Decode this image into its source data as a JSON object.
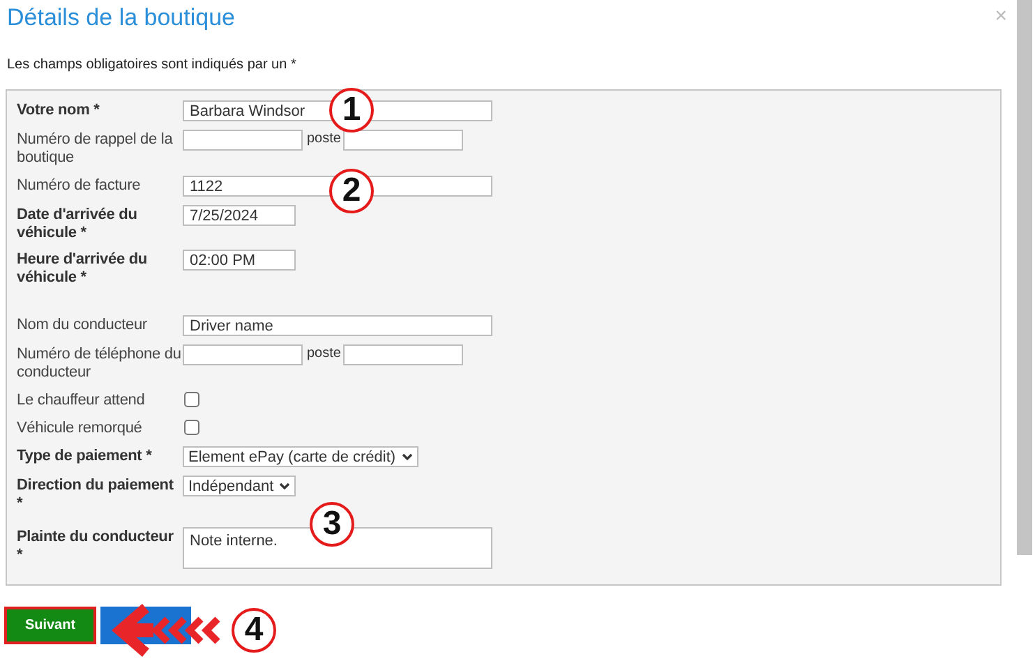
{
  "dialog": {
    "title": "Détails de la boutique",
    "close": "×",
    "note": "Les champs obligatoires sont indiqués par un *"
  },
  "fields": [
    {
      "kind": "text",
      "label": "Votre nom *",
      "required": true,
      "value": "Barbara Windsor"
    },
    {
      "kind": "phone",
      "label": "Numéro de rappel de la boutique",
      "required": false,
      "ext_label": "poste"
    },
    {
      "kind": "text",
      "label": "Numéro de facture",
      "required": false,
      "value": "1122"
    },
    {
      "kind": "short",
      "label": "Date d'arrivée du véhicule *",
      "required": true,
      "value": "7/25/2024"
    },
    {
      "kind": "short",
      "label": "Heure d'arrivée du véhicule *",
      "required": true,
      "value": "02:00 PM"
    },
    {
      "kind": "text",
      "label": "Nom du conducteur",
      "required": false,
      "value": "Driver name"
    },
    {
      "kind": "phone",
      "label": "Numéro de téléphone du conducteur",
      "required": false,
      "ext_label": "poste"
    },
    {
      "kind": "checkbox",
      "label": "Le chauffeur attend",
      "required": false,
      "checked": false
    },
    {
      "kind": "checkbox",
      "label": "Véhicule remorqué",
      "required": false,
      "checked": false
    },
    {
      "kind": "select",
      "label": "Type de paiement *",
      "required": true,
      "value": "Element ePay (carte de crédit)"
    },
    {
      "kind": "select",
      "label": "Direction du paiement *",
      "required": true,
      "value": "Indépendant"
    },
    {
      "kind": "textarea",
      "label": "Plainte du conducteur *",
      "required": true,
      "value": "Note interne."
    }
  ],
  "buttons": [
    {
      "label": "Suivant",
      "highlighted": true
    }
  ],
  "callouts": [
    "1",
    "2",
    "3",
    "4"
  ]
}
